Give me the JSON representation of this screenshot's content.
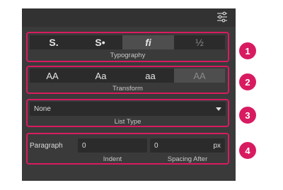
{
  "typography": {
    "buttons": [
      "S.",
      "S•",
      "fi",
      "½"
    ],
    "selected_index": 2,
    "caption": "Typography"
  },
  "transform": {
    "buttons": [
      "AA",
      "Aa",
      "aa",
      "AA"
    ],
    "caption": "Transform"
  },
  "list_type": {
    "value": "None",
    "caption": "List Type"
  },
  "paragraph": {
    "label": "Paragraph",
    "indent_value": "0",
    "indent_caption": "Indent",
    "spacing_value": "0",
    "spacing_unit": "px",
    "spacing_caption": "Spacing After"
  },
  "callouts": [
    "1",
    "2",
    "3",
    "4"
  ],
  "colors": {
    "highlight": "#d81b60",
    "panel": "#3a3a3a"
  }
}
